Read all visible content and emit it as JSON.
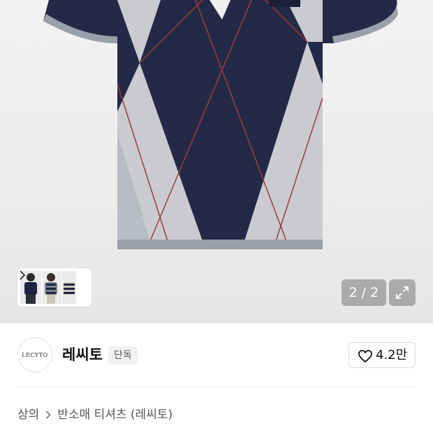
{
  "gallery": {
    "page_counter": "2 / 2",
    "current_page": 2,
    "total_pages": 2
  },
  "brand": {
    "logo_text": "LECYTO",
    "name": "레씨토",
    "badge": "단독"
  },
  "like": {
    "count": "4.2만"
  },
  "breadcrumb": {
    "category": "상의",
    "subcategory": "반소매 티셔츠 (레씨토)"
  },
  "colors": {
    "navy": "#232a47",
    "argyle_grey": "#c9cbd0",
    "trim_grey": "#9aa0aa",
    "red_stripe": "#9c3b3b"
  }
}
